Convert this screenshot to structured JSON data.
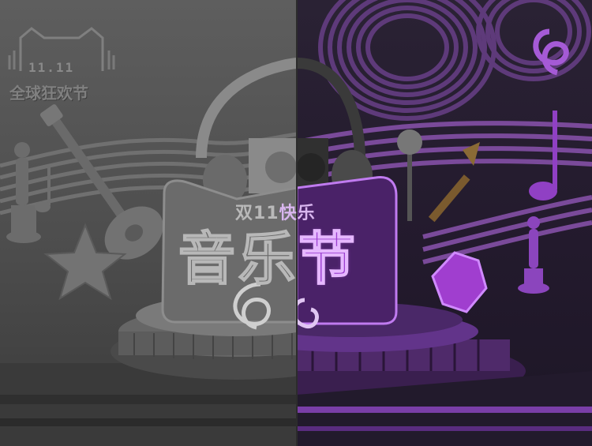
{
  "logo": {
    "date_mark": "11.11",
    "slogan": "全球狂欢节"
  },
  "banner": {
    "subtitle_left": "双11",
    "subtitle_right": "快乐",
    "title_char_1": "音",
    "title_char_2": "乐",
    "title_char_3": "节"
  },
  "colors": {
    "left_bg": "#555555",
    "right_bg": "#251c30",
    "accent_purple": "#9b3fcf",
    "accent_glow": "#e6b8ff"
  }
}
